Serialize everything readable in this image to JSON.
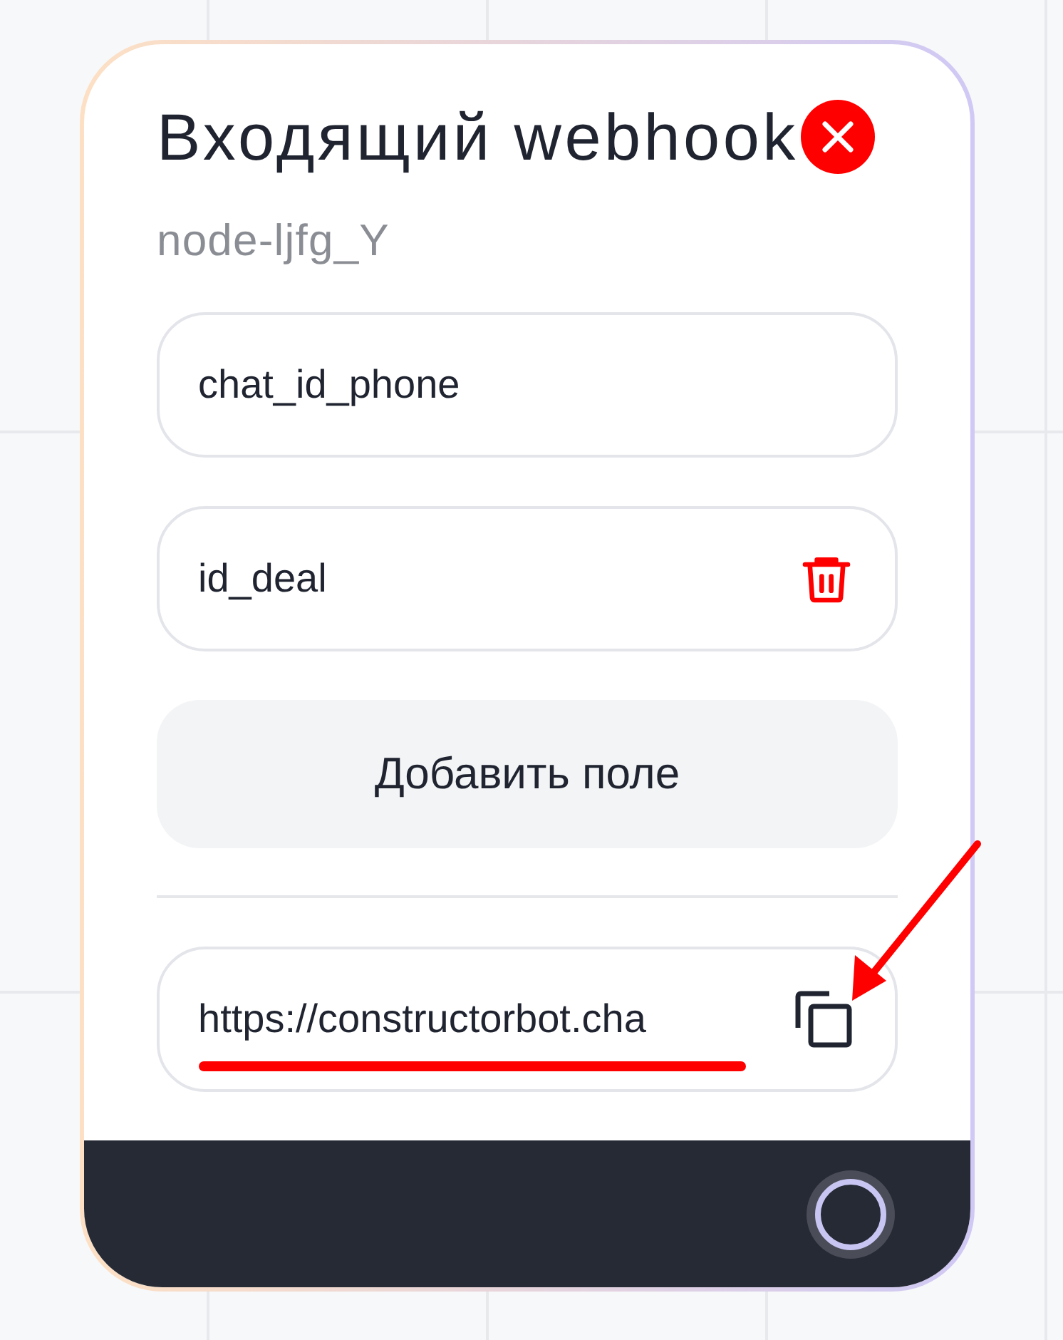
{
  "node": {
    "title": "Входящий webhook",
    "node_id": "node-ljfg_Y",
    "fields": [
      {
        "value": "chat_id_phone",
        "kind": "plain"
      },
      {
        "value": "id_deal",
        "kind": "deletable"
      }
    ],
    "add_button": "Добавить поле",
    "webhook_url": "https://constructorbot.cha"
  }
}
